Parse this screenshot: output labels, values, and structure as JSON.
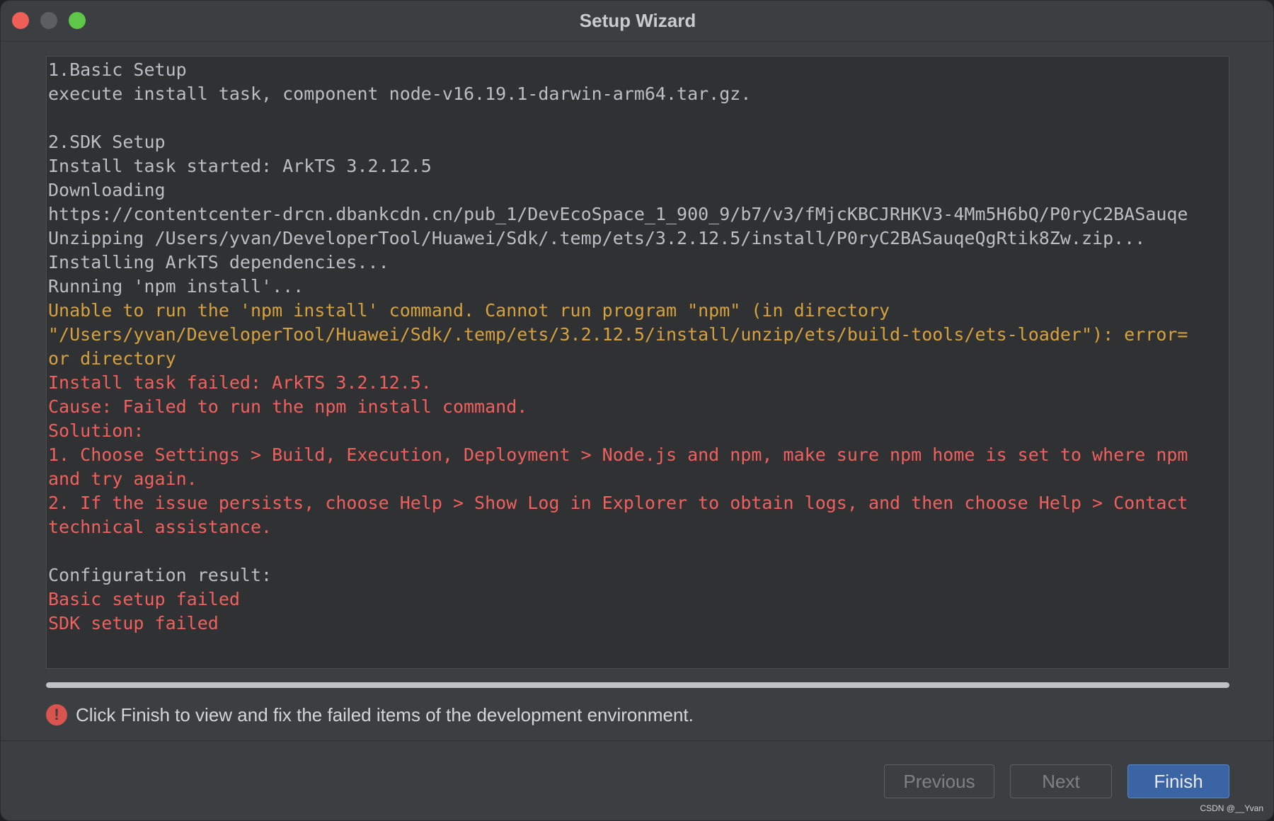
{
  "window": {
    "title": "Setup Wizard",
    "accent_color": "#3a64a4",
    "error_color": "#f0605e",
    "warning_color": "#d6a13e"
  },
  "log": {
    "lines": [
      {
        "text": "1.Basic Setup",
        "level": "normal"
      },
      {
        "text": "execute install task, component node-v16.19.1-darwin-arm64.tar.gz.",
        "level": "normal"
      },
      {
        "text": "",
        "level": "normal"
      },
      {
        "text": "2.SDK Setup",
        "level": "normal"
      },
      {
        "text": "Install task started: ArkTS 3.2.12.5",
        "level": "normal"
      },
      {
        "text": "Downloading",
        "level": "normal"
      },
      {
        "text": "https://contentcenter-drcn.dbankcdn.cn/pub_1/DevEcoSpace_1_900_9/b7/v3/fMjcKBCJRHKV3-4Mm5H6bQ/P0ryC2BASauqe",
        "level": "normal"
      },
      {
        "text": "Unzipping /Users/yvan/DeveloperTool/Huawei/Sdk/.temp/ets/3.2.12.5/install/P0ryC2BASauqeQgRtik8Zw.zip...",
        "level": "normal"
      },
      {
        "text": "Installing ArkTS dependencies...",
        "level": "normal"
      },
      {
        "text": "Running 'npm install'...",
        "level": "normal"
      },
      {
        "text": "Unable to run the 'npm install' command. Cannot run program \"npm\" (in directory",
        "level": "warning"
      },
      {
        "text": "\"/Users/yvan/DeveloperTool/Huawei/Sdk/.temp/ets/3.2.12.5/install/unzip/ets/build-tools/ets-loader\"): error=",
        "level": "warning"
      },
      {
        "text": "or directory",
        "level": "warning"
      },
      {
        "text": "Install task failed: ArkTS 3.2.12.5.",
        "level": "error"
      },
      {
        "text": "Cause: Failed to run the npm install command.",
        "level": "error"
      },
      {
        "text": "Solution:",
        "level": "error"
      },
      {
        "text": "1. Choose Settings > Build, Execution, Deployment > Node.js and npm, make sure npm home is set to where npm",
        "level": "error"
      },
      {
        "text": "and try again.",
        "level": "error"
      },
      {
        "text": "2. If the issue persists, choose Help > Show Log in Explorer to obtain logs, and then choose Help > Contact",
        "level": "error"
      },
      {
        "text": "technical assistance.",
        "level": "error"
      },
      {
        "text": "",
        "level": "normal"
      },
      {
        "text": "Configuration result:",
        "level": "normal"
      },
      {
        "text": "Basic setup failed",
        "level": "error"
      },
      {
        "text": "SDK setup failed",
        "level": "error"
      }
    ]
  },
  "progress": {
    "fraction": 1.0
  },
  "status": {
    "icon": "error-icon",
    "icon_glyph": "!",
    "message": "Click Finish to view and fix the failed items of the development environment."
  },
  "buttons": {
    "previous_label": "Previous",
    "next_label": "Next",
    "finish_label": "Finish"
  },
  "watermark": "CSDN @__Yvan"
}
